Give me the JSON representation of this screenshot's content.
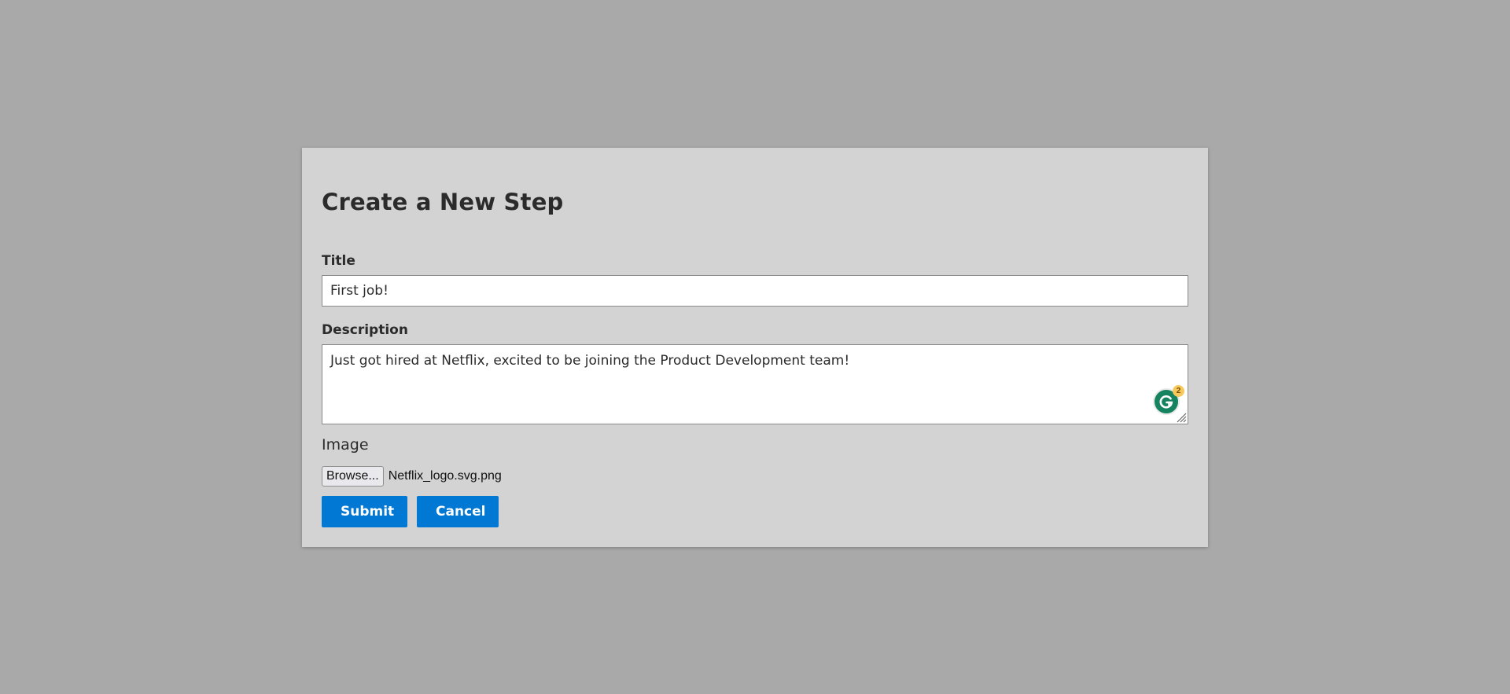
{
  "modal": {
    "title": "Create a New Step"
  },
  "form": {
    "title_label": "Title",
    "title_value": "First job!",
    "description_label": "Description",
    "description_value": "Just got hired at Netflix, excited to be joining the Product Development team!",
    "image_label": "Image",
    "browse_label": "Browse...",
    "file_name": "Netflix_logo.svg.png",
    "submit_label": "Submit",
    "cancel_label": "Cancel"
  },
  "grammarly": {
    "icon": "grammarly-icon",
    "count": "2",
    "color": "#15835f"
  },
  "colors": {
    "backdrop": "#a9a9a9",
    "modal_bg": "#d3d3d3",
    "primary_button": "#0078d4"
  }
}
